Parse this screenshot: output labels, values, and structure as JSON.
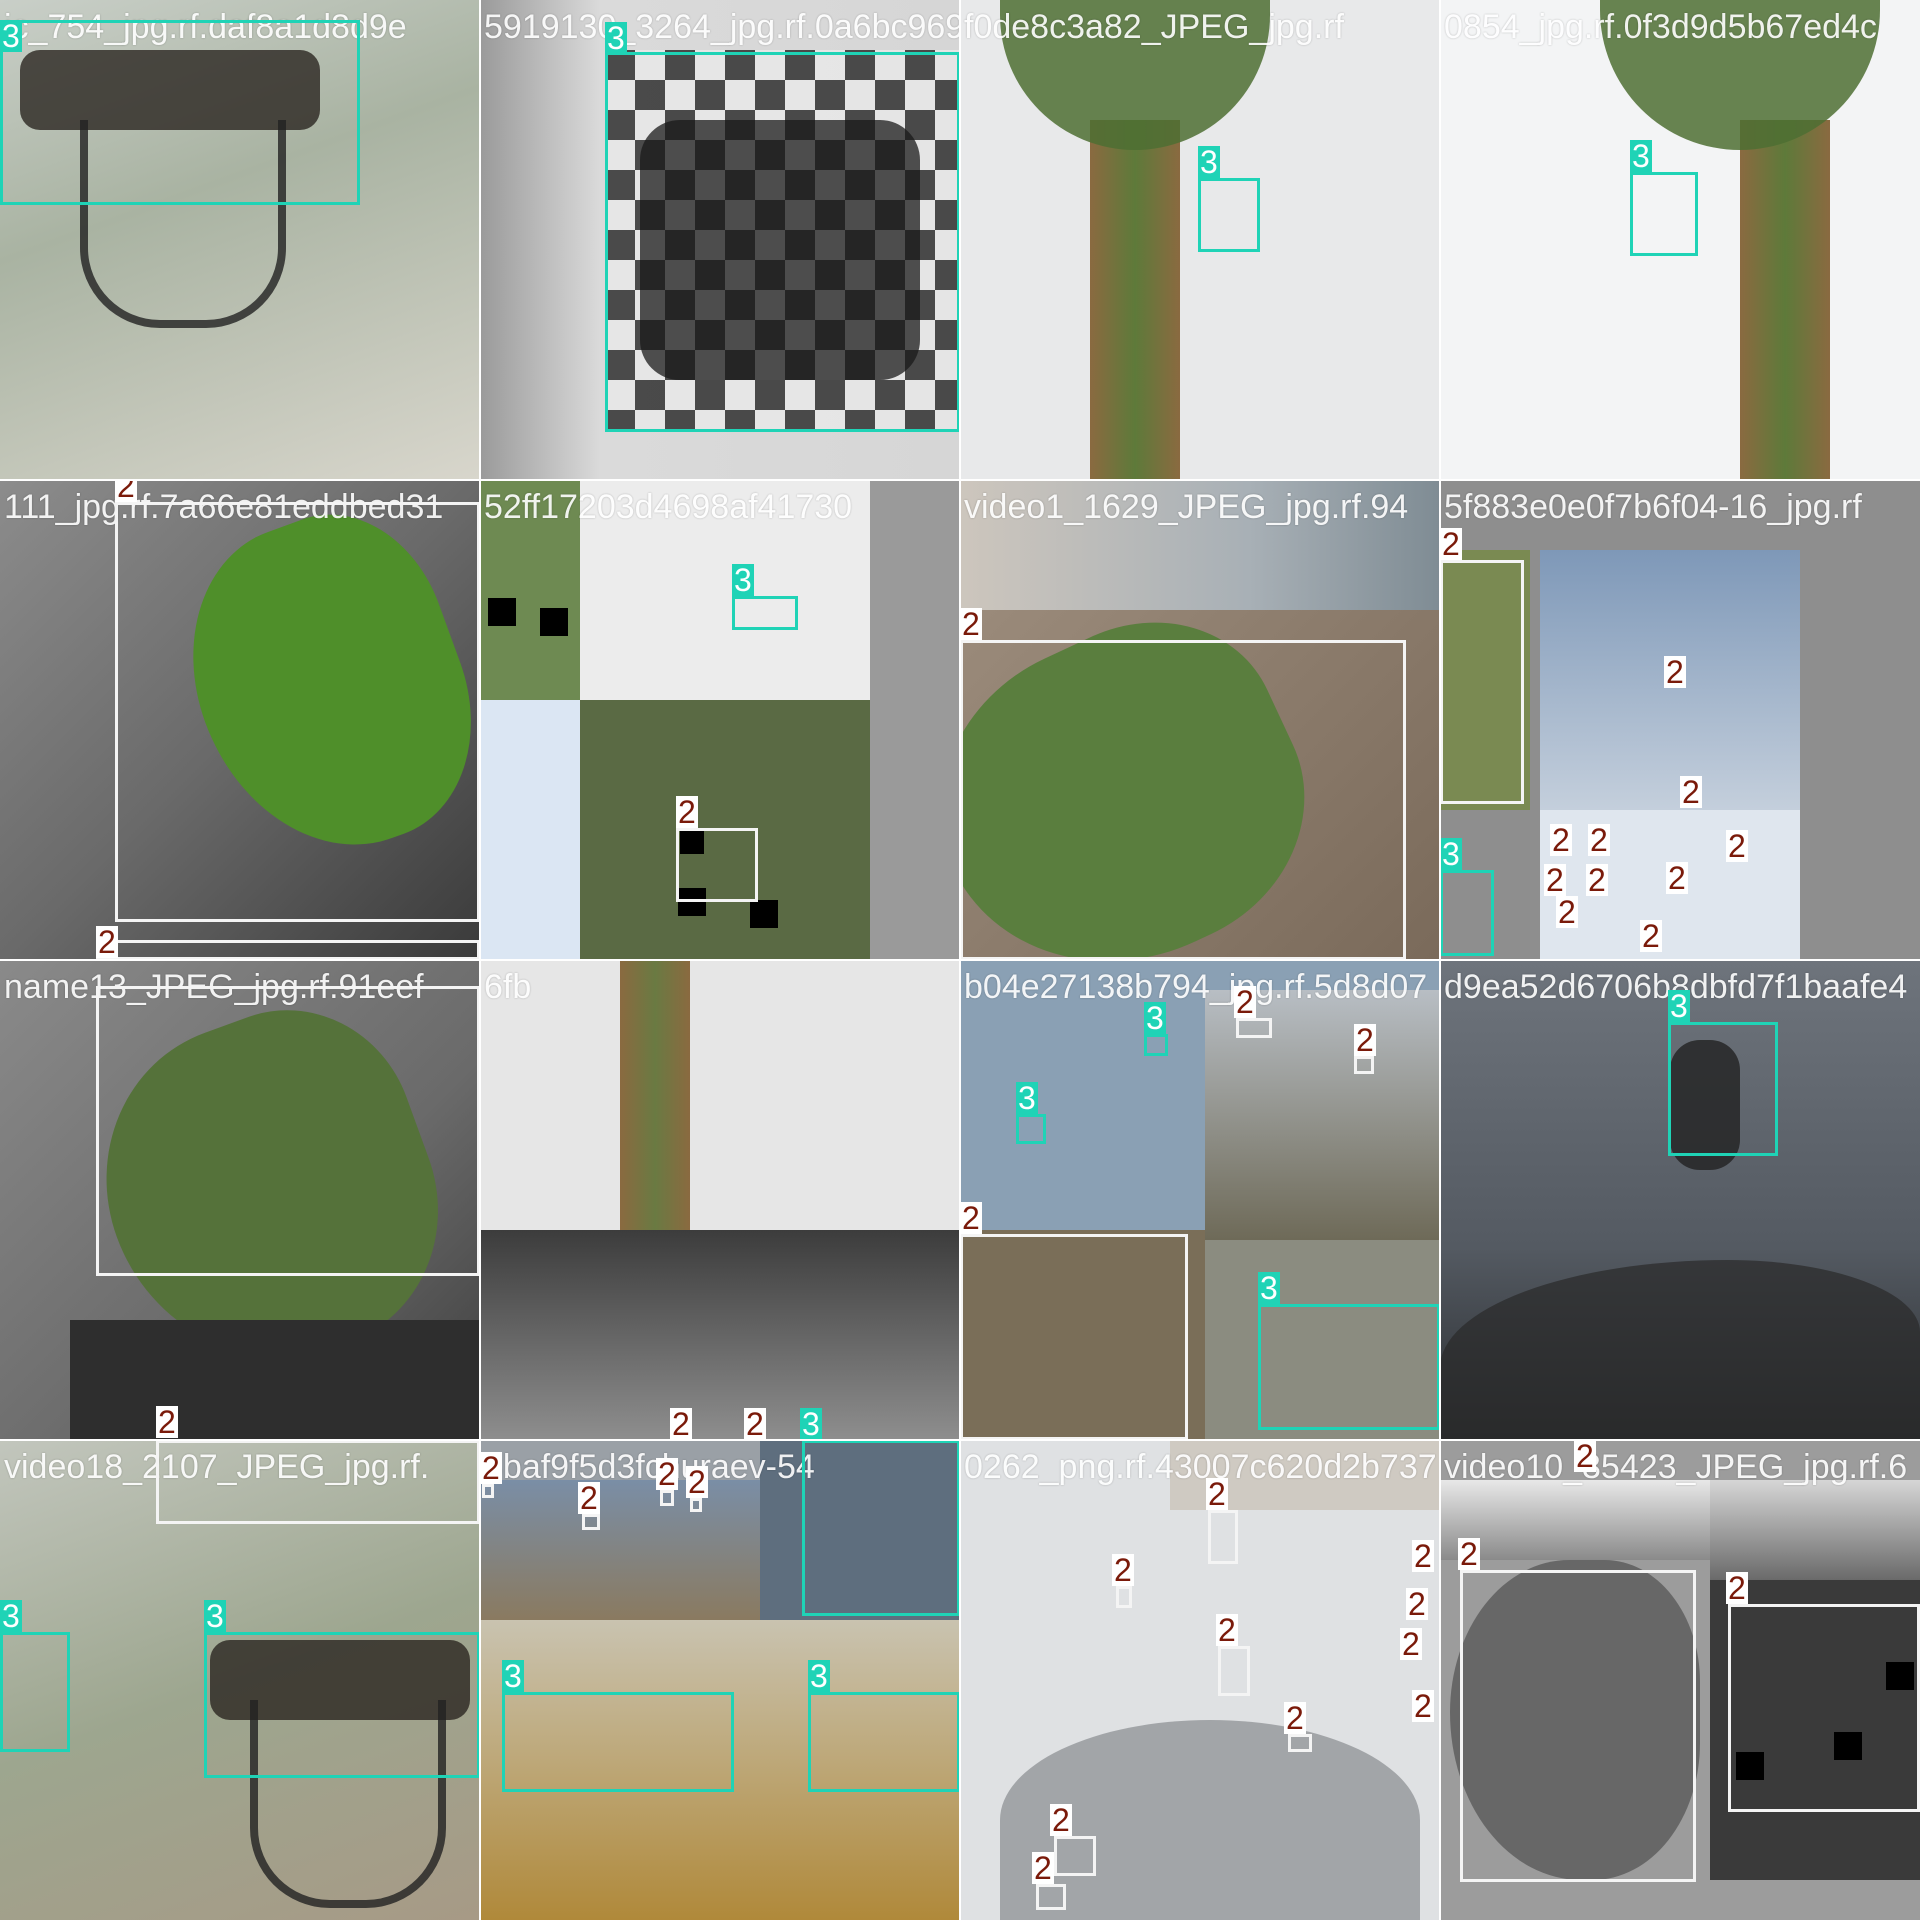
{
  "tiles": [
    {
      "title": "ic_754_jpg.rf.daf8a1d8d9e"
    },
    {
      "title": "5919130_3264_jpg.rf.0a6bc969"
    },
    {
      "title": "f0de8c3a82_JPEG_jpg.rf"
    },
    {
      "title": "0854_jpg.rf.0f3d9d5b67ed4c"
    },
    {
      "title": "111_jpg.rf.7a66e81eddbed31"
    },
    {
      "title": "52ff17203d4698af41730"
    },
    {
      "title": "video1_1629_JPEG_jpg.rf.94"
    },
    {
      "title": "5f883e0e0f7b6f04-16_jpg.rf"
    },
    {
      "title": "name13_JPEG_jpg.rf.91eef"
    },
    {
      "title": "6fb"
    },
    {
      "title": "b04e27138b794_jpg.rf.5d8d07"
    },
    {
      "title": "d9ea52d6706b8dbfd7f1baafe4"
    },
    {
      "title": "video18_2107_JPEG_jpg.rf."
    },
    {
      "title": "8baf9f5d3fchuraev-54"
    },
    {
      "title": "0262_png.rf.43007c620d2b737"
    },
    {
      "title": "video10_35423_JPEG_jpg.rf.6"
    }
  ],
  "labels": {
    "drone": "3",
    "bird": "2"
  },
  "colors": {
    "drone_box": "#1fd3b6",
    "bird_box": "#f4f4f4",
    "bird_text": "#7a1a0a"
  }
}
